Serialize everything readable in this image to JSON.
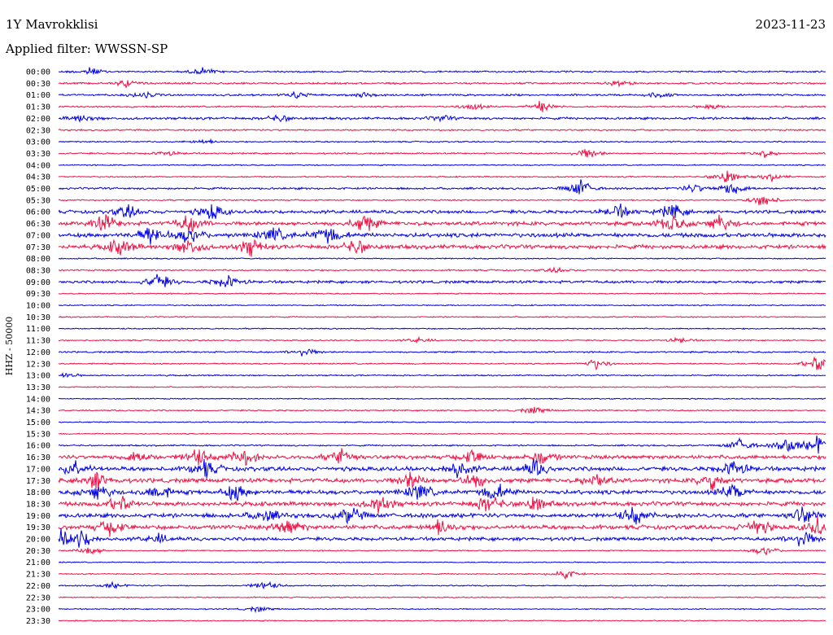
{
  "header": {
    "station": "1Y Mavrokklisi",
    "date": "2023-11-23",
    "filter": "Applied filter: WWSSN-SP"
  },
  "chart_data": {
    "type": "line",
    "chart_kind": "helicorder",
    "ylabel": "HHZ - 50000",
    "colors": [
      "#0000e6",
      "#ee1144"
    ],
    "rows": [
      {
        "label": "00:00",
        "activity": 0.25,
        "events": [
          [
            0.04,
            0.5
          ],
          [
            0.19,
            0.45
          ]
        ]
      },
      {
        "label": "00:30",
        "activity": 0.3,
        "events": [
          [
            0.09,
            0.4
          ],
          [
            0.73,
            0.3
          ]
        ]
      },
      {
        "label": "01:00",
        "activity": 0.3,
        "events": [
          [
            0.11,
            0.4
          ],
          [
            0.31,
            0.4
          ],
          [
            0.4,
            0.3
          ],
          [
            0.78,
            0.3
          ]
        ]
      },
      {
        "label": "01:30",
        "activity": 0.2,
        "events": [
          [
            0.54,
            0.4
          ],
          [
            0.63,
            0.7
          ],
          [
            0.85,
            0.3
          ]
        ]
      },
      {
        "label": "02:00",
        "activity": 0.45,
        "events": [
          [
            0.03,
            0.4
          ],
          [
            0.29,
            0.4
          ],
          [
            0.5,
            0.3
          ]
        ]
      },
      {
        "label": "02:30",
        "activity": 0.2,
        "events": []
      },
      {
        "label": "03:00",
        "activity": 0.15,
        "events": [
          [
            0.19,
            0.3
          ]
        ]
      },
      {
        "label": "03:30",
        "activity": 0.2,
        "events": [
          [
            0.14,
            0.3
          ],
          [
            0.69,
            0.6
          ],
          [
            0.92,
            0.4
          ]
        ]
      },
      {
        "label": "04:00",
        "activity": 0.1,
        "events": []
      },
      {
        "label": "04:30",
        "activity": 0.15,
        "events": [
          [
            0.87,
            0.9
          ],
          [
            0.93,
            0.4
          ]
        ]
      },
      {
        "label": "05:00",
        "activity": 0.35,
        "events": [
          [
            0.68,
            1.0
          ],
          [
            0.83,
            0.5
          ],
          [
            0.88,
            1.0
          ]
        ]
      },
      {
        "label": "05:30",
        "activity": 0.15,
        "events": [
          [
            0.92,
            0.8
          ]
        ]
      },
      {
        "label": "06:00",
        "activity": 0.7,
        "events": [
          [
            0.09,
            0.8
          ],
          [
            0.2,
            1.0
          ],
          [
            0.73,
            0.8
          ],
          [
            0.8,
            0.9
          ]
        ]
      },
      {
        "label": "06:30",
        "activity": 0.9,
        "events": [
          [
            0.06,
            1.0
          ],
          [
            0.17,
            1.0
          ],
          [
            0.4,
            1.0
          ],
          [
            0.8,
            1.0
          ],
          [
            0.86,
            1.0
          ]
        ]
      },
      {
        "label": "07:00",
        "activity": 1.0,
        "events": [
          [
            0.12,
            1.0
          ],
          [
            0.17,
            1.0
          ],
          [
            0.28,
            0.8
          ],
          [
            0.35,
            1.0
          ]
        ]
      },
      {
        "label": "07:30",
        "activity": 0.95,
        "events": [
          [
            0.08,
            1.0
          ],
          [
            0.17,
            1.0
          ],
          [
            0.25,
            1.0
          ],
          [
            0.39,
            0.9
          ]
        ]
      },
      {
        "label": "08:00",
        "activity": 0.12,
        "events": []
      },
      {
        "label": "08:30",
        "activity": 0.2,
        "events": [
          [
            0.65,
            0.3
          ]
        ]
      },
      {
        "label": "09:00",
        "activity": 0.55,
        "events": [
          [
            0.13,
            1.0
          ],
          [
            0.22,
            0.8
          ]
        ]
      },
      {
        "label": "09:30",
        "activity": 0.12,
        "events": []
      },
      {
        "label": "10:00",
        "activity": 0.1,
        "events": []
      },
      {
        "label": "10:30",
        "activity": 0.1,
        "events": []
      },
      {
        "label": "11:00",
        "activity": 0.12,
        "events": []
      },
      {
        "label": "11:30",
        "activity": 0.12,
        "events": [
          [
            0.47,
            0.3
          ],
          [
            0.81,
            0.3
          ]
        ]
      },
      {
        "label": "12:00",
        "activity": 0.2,
        "events": [
          [
            0.32,
            0.5
          ]
        ]
      },
      {
        "label": "12:30",
        "activity": 0.15,
        "events": [
          [
            0.7,
            0.6
          ],
          [
            0.99,
            1.0
          ]
        ]
      },
      {
        "label": "13:00",
        "activity": 0.15,
        "events": [
          [
            0.01,
            0.3
          ]
        ]
      },
      {
        "label": "13:30",
        "activity": 0.08,
        "events": []
      },
      {
        "label": "14:00",
        "activity": 0.08,
        "events": []
      },
      {
        "label": "14:30",
        "activity": 0.15,
        "events": [
          [
            0.62,
            0.4
          ]
        ]
      },
      {
        "label": "15:00",
        "activity": 0.08,
        "events": []
      },
      {
        "label": "15:30",
        "activity": 0.08,
        "events": []
      },
      {
        "label": "16:00",
        "activity": 0.2,
        "events": [
          [
            0.89,
            0.8
          ],
          [
            0.95,
            1.0
          ],
          [
            0.99,
            1.0
          ]
        ]
      },
      {
        "label": "16:30",
        "activity": 0.9,
        "events": [
          [
            0.1,
            0.8
          ],
          [
            0.18,
            1.0
          ],
          [
            0.24,
            1.0
          ],
          [
            0.37,
            1.0
          ],
          [
            0.54,
            1.0
          ],
          [
            0.63,
            0.8
          ]
        ]
      },
      {
        "label": "17:00",
        "activity": 1.0,
        "events": [
          [
            0.02,
            1.0
          ],
          [
            0.19,
            1.0
          ],
          [
            0.52,
            1.0
          ],
          [
            0.62,
            0.9
          ],
          [
            0.88,
            1.0
          ]
        ]
      },
      {
        "label": "17:30",
        "activity": 1.0,
        "events": [
          [
            0.05,
            1.0
          ],
          [
            0.46,
            1.0
          ],
          [
            0.54,
            1.0
          ],
          [
            0.7,
            0.8
          ],
          [
            0.85,
            1.0
          ]
        ]
      },
      {
        "label": "18:00",
        "activity": 1.0,
        "events": [
          [
            0.05,
            1.0
          ],
          [
            0.13,
            1.0
          ],
          [
            0.23,
            1.0
          ],
          [
            0.47,
            1.0
          ],
          [
            0.57,
            1.0
          ],
          [
            0.88,
            1.0
          ]
        ]
      },
      {
        "label": "18:30",
        "activity": 1.0,
        "events": [
          [
            0.08,
            1.0
          ],
          [
            0.42,
            1.0
          ],
          [
            0.56,
            1.0
          ],
          [
            0.62,
            0.9
          ]
        ]
      },
      {
        "label": "19:00",
        "activity": 1.0,
        "events": [
          [
            0.27,
            0.8
          ],
          [
            0.38,
            1.0
          ],
          [
            0.75,
            1.0
          ],
          [
            0.97,
            1.0
          ]
        ]
      },
      {
        "label": "19:30",
        "activity": 1.0,
        "events": [
          [
            0.07,
            1.0
          ],
          [
            0.3,
            1.0
          ],
          [
            0.5,
            1.0
          ],
          [
            0.91,
            1.0
          ],
          [
            0.99,
            1.0
          ]
        ]
      },
      {
        "label": "20:00",
        "activity": 0.75,
        "events": [
          [
            0.0,
            1.0
          ],
          [
            0.03,
            1.0
          ],
          [
            0.13,
            0.5
          ],
          [
            0.97,
            1.0
          ]
        ]
      },
      {
        "label": "20:30",
        "activity": 0.1,
        "events": [
          [
            0.04,
            0.6
          ],
          [
            0.92,
            0.6
          ]
        ]
      },
      {
        "label": "21:00",
        "activity": 0.05,
        "events": []
      },
      {
        "label": "21:30",
        "activity": 0.08,
        "events": [
          [
            0.66,
            0.6
          ]
        ]
      },
      {
        "label": "22:00",
        "activity": 0.12,
        "events": [
          [
            0.07,
            0.3
          ],
          [
            0.27,
            0.6
          ]
        ]
      },
      {
        "label": "22:30",
        "activity": 0.08,
        "events": []
      },
      {
        "label": "23:00",
        "activity": 0.08,
        "events": [
          [
            0.26,
            0.3
          ]
        ]
      },
      {
        "label": "23:30",
        "activity": 0.08,
        "events": []
      }
    ]
  }
}
